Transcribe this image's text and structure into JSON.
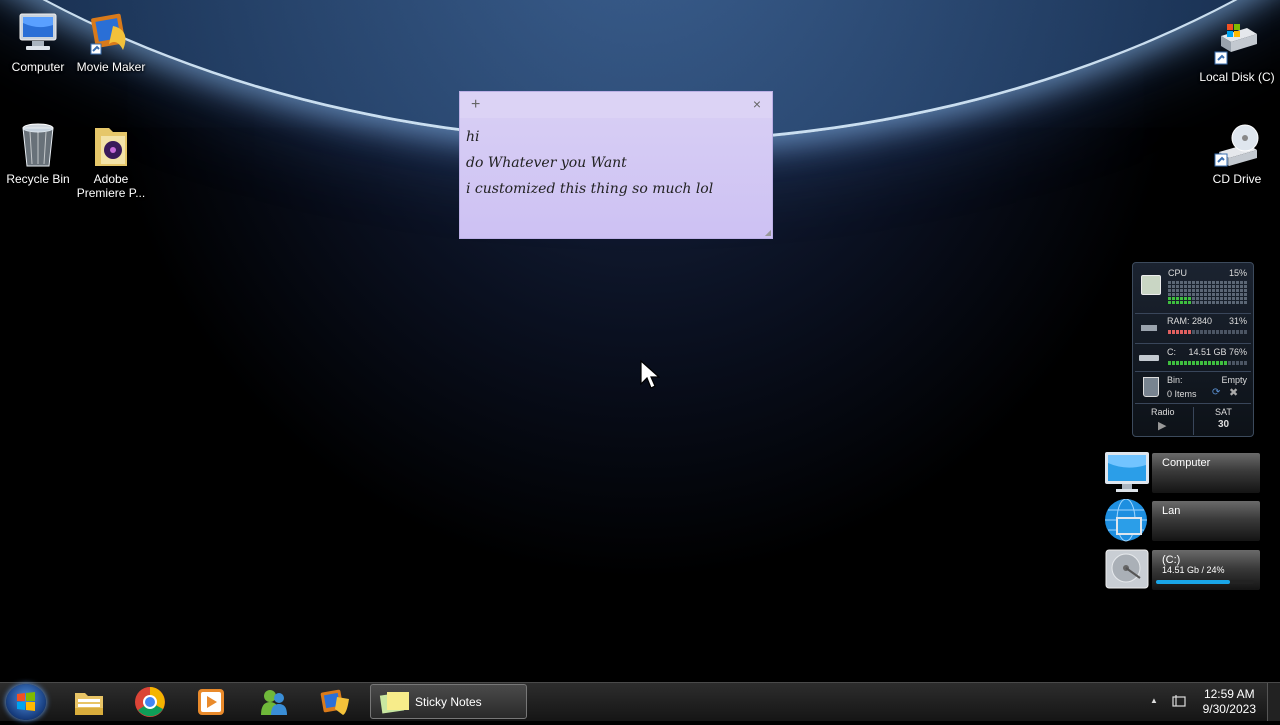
{
  "desktop": {
    "icons": [
      {
        "label": "Computer",
        "icon": "computer-icon"
      },
      {
        "label": "Movie Maker",
        "icon": "movie-maker-icon"
      },
      {
        "label": "Recycle Bin",
        "icon": "recycle-bin-icon"
      },
      {
        "label": "Adobe Premiere P...",
        "icon": "premiere-folder-icon"
      },
      {
        "label": "Local Disk (C)",
        "icon": "local-disk-icon"
      },
      {
        "label": "CD Drive",
        "icon": "cd-drive-icon"
      }
    ]
  },
  "sticky_note": {
    "add_glyph": "+",
    "close_glyph": "×",
    "lines": [
      "hi",
      "do Whatever you Want",
      "i customized this thing so much lol"
    ]
  },
  "gadget": {
    "cpu_label": "CPU",
    "cpu_percent": "15%",
    "cpu_level": 0.15,
    "ram_label": "RAM: 2840",
    "ram_percent": "31%",
    "ram_level": 0.31,
    "drive_label": "C:",
    "drive_value": "14.51 GB 76%",
    "drive_level": 0.76,
    "bin_label": "Bin:",
    "bin_status": "Empty",
    "bin_items": "0 Items",
    "radio_label": "Radio",
    "radio_play": "▶",
    "day": "SAT",
    "date": "30"
  },
  "widgets": {
    "computer_label": "Computer",
    "lan_label": "Lan",
    "drive_label": "(C:)",
    "drive_detail": "14.51 Gb / 24%",
    "drive_level": 0.76
  },
  "taskbar": {
    "active_window": "Sticky Notes",
    "time": "12:59 AM",
    "date": "9/30/2023",
    "tray_arrow": "▲",
    "pinned": [
      "explorer-icon",
      "chrome-icon",
      "media-player-icon",
      "messenger-icon",
      "movie-maker-icon"
    ]
  },
  "colors": {
    "sticky_bg": "#cdc1f3",
    "taskbar_bg": "#1b1b1b",
    "widget_bar": "#1aa6e8"
  }
}
